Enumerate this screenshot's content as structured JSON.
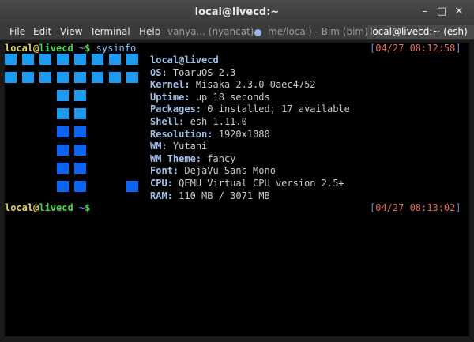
{
  "window": {
    "title": "local@livecd:~"
  },
  "controls": {
    "minimize": "–",
    "maximize": "□",
    "close": "✕"
  },
  "menu": [
    "File",
    "Edit",
    "View",
    "Terminal",
    "Help"
  ],
  "tabs": [
    {
      "label": "vanya... (nyancat)"
    },
    {
      "label": "me/local) - Bim (bim)"
    },
    {
      "label": "local@livecd:~ (esh)"
    }
  ],
  "prompt": {
    "user": "local",
    "at": "@",
    "host": "livecd",
    "path": " ~",
    "symbol": "$",
    "command": "sysinfo"
  },
  "timestamps": {
    "first": "04/27 08:12:58",
    "second": "04/27 08:13:02"
  },
  "sysinfo": {
    "header": "local@livecd",
    "rows": [
      {
        "label": "OS:",
        "value": "ToaruOS 2.3"
      },
      {
        "label": "Kernel:",
        "value": "Misaka 2.3.0-0aec4752"
      },
      {
        "label": "Uptime:",
        "value": "up 18 seconds"
      },
      {
        "label": "Packages:",
        "value": "0 installed; 17 available"
      },
      {
        "label": "Shell:",
        "value": "esh 1.11.0"
      },
      {
        "label": "Resolution:",
        "value": "1920x1080"
      },
      {
        "label": "WM:",
        "value": "Yutani"
      },
      {
        "label": "WM Theme:",
        "value": "fancy"
      },
      {
        "label": "Font:",
        "value": "DejaVu Sans Mono"
      },
      {
        "label": "CPU:",
        "value": "QEMU Virtual CPU version 2.5+"
      },
      {
        "label": "RAM:",
        "value": "110 MB / 3071 MB"
      }
    ]
  },
  "colors": {
    "logo_light": "#1e9bef",
    "logo_dark": "#0c64f2"
  }
}
